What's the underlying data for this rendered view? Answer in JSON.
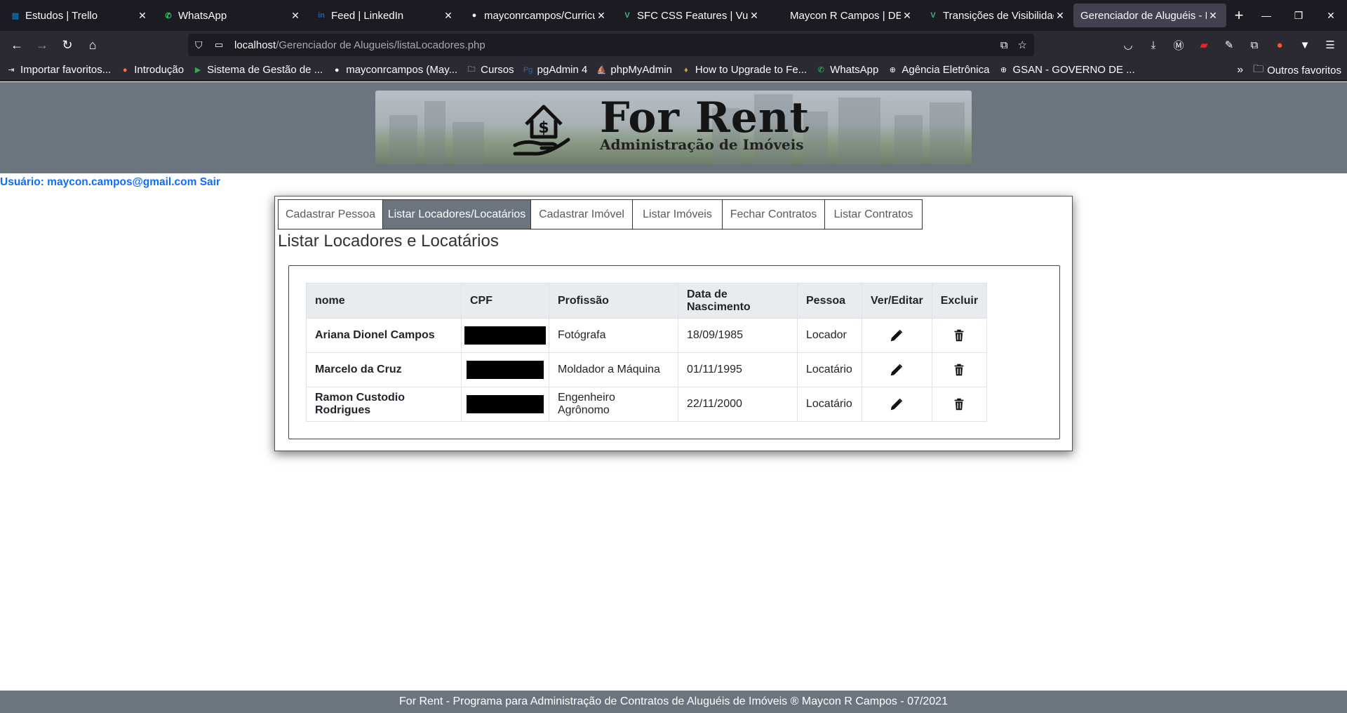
{
  "browser": {
    "tabs": [
      {
        "label": "Estudos | Trello",
        "icon": "trello-icon",
        "color": "#0079bf",
        "glyph": "▥"
      },
      {
        "label": "WhatsApp",
        "icon": "whatsapp-icon",
        "color": "#25d366",
        "glyph": "✆"
      },
      {
        "label": "Feed | LinkedIn",
        "icon": "linkedin-icon",
        "color": "#0a66c2",
        "glyph": "in"
      },
      {
        "label": "mayconrcampos/Curricu",
        "icon": "github-icon",
        "color": "#fbfbfe",
        "glyph": "●"
      },
      {
        "label": "SFC CSS Features | Vue.j",
        "icon": "vue-icon",
        "color": "#41b883",
        "glyph": "V"
      },
      {
        "label": "Maycon R Campos | DEV Ful",
        "icon": "dev-icon",
        "color": "#2b2a33",
        "glyph": ""
      },
      {
        "label": "Transições de Visibilidad",
        "icon": "vue-icon",
        "color": "#41b883",
        "glyph": "V"
      },
      {
        "label": "Gerenciador de Aluguéis - Li",
        "icon": "",
        "color": "#42414d",
        "glyph": ""
      }
    ],
    "url_host": "localhost",
    "url_path": "/Gerenciador de Alugueis/listaLocadores.php",
    "bookmarks": [
      {
        "label": "Importar favoritos...",
        "icon": "import-icon",
        "glyph": "⇥",
        "color": "#fbfbfe"
      },
      {
        "label": "Introdução",
        "icon": "firefox-icon",
        "glyph": "●",
        "color": "#ff7139"
      },
      {
        "label": "Sistema de Gestão de ...",
        "icon": "play-icon",
        "glyph": "▶",
        "color": "#34a853"
      },
      {
        "label": "mayconrcampos (May...",
        "icon": "github-icon",
        "glyph": "●",
        "color": "#fbfbfe"
      },
      {
        "label": "Cursos",
        "icon": "folder-icon",
        "glyph": "🗀",
        "color": "#fbfbfe"
      },
      {
        "label": "pgAdmin 4",
        "icon": "pgadmin-icon",
        "glyph": "Pg",
        "color": "#336791"
      },
      {
        "label": "phpMyAdmin",
        "icon": "phpmyadmin-icon",
        "glyph": "⛵",
        "color": "#f89c0e"
      },
      {
        "label": "How to Upgrade to Fe...",
        "icon": "fedora-icon",
        "glyph": "♦",
        "color": "#d1a53c"
      },
      {
        "label": "WhatsApp",
        "icon": "whatsapp-icon",
        "glyph": "✆",
        "color": "#25d366"
      },
      {
        "label": "Agência Eletrônica",
        "icon": "globe-icon",
        "glyph": "⊕",
        "color": "#fbfbfe"
      },
      {
        "label": "GSAN - GOVERNO DE ...",
        "icon": "globe-icon",
        "glyph": "⊕",
        "color": "#fbfbfe"
      }
    ],
    "other_bookmarks": "Outros favoritos"
  },
  "header": {
    "brand": "For Rent",
    "tagline": "Administração de Imóveis"
  },
  "user": {
    "text": "Usuário: maycon.campos@gmail.com Sair"
  },
  "tabs": [
    {
      "label": "Cadastrar Pessoa",
      "active": false
    },
    {
      "label": "Listar Locadores/Locatários",
      "active": true
    },
    {
      "label": "Cadastrar Imóvel",
      "active": false
    },
    {
      "label": "Listar Imóveis",
      "active": false
    },
    {
      "label": "Fechar Contratos",
      "active": false
    },
    {
      "label": "Listar Contratos",
      "active": false
    }
  ],
  "page_title": "Listar Locadores e Locatários",
  "table": {
    "headers": [
      "nome",
      "CPF",
      "Profissão",
      "Data de Nascimento",
      "Pessoa",
      "Ver/Editar",
      "Excluir"
    ],
    "rows": [
      {
        "nome": "Ariana Dionel Campos",
        "profissao": "Fotógrafa",
        "nascimento": "18/09/1985",
        "pessoa": "Locador"
      },
      {
        "nome": "Marcelo da Cruz",
        "profissao": "Moldador a Máquina",
        "nascimento": "01/11/1995",
        "pessoa": "Locatário"
      },
      {
        "nome": "Ramon Custodio Rodrigues",
        "profissao": "Engenheiro Agrônomo",
        "nascimento": "22/11/2000",
        "pessoa": "Locatário"
      }
    ]
  },
  "footer": "For Rent - Programa para Administração de Contratos de Aluguéis de Imóveis ® Maycon R Campos - 07/2021",
  "colors": {
    "accent": "#6c757d",
    "link": "#0d6efd"
  }
}
